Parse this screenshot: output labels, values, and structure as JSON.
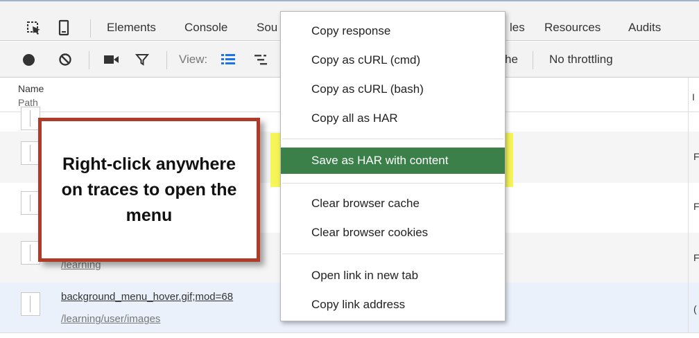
{
  "tabs": {
    "items": [
      "Elements",
      "Console",
      "Sou",
      "les",
      "Resources",
      "Audits"
    ]
  },
  "toolbar": {
    "view_label": "View:",
    "cache_fragment": "he",
    "throttling": "No throttling"
  },
  "table": {
    "header_name": "Name",
    "header_path": "Path",
    "header_right": "I",
    "rows": [
      {
        "name": "",
        "path": "",
        "right": ""
      },
      {
        "name": "",
        "path": "",
        "right": "F"
      },
      {
        "name": "",
        "path": "",
        "right": "F"
      },
      {
        "name": "",
        "path": "/learning",
        "right": "F"
      },
      {
        "name": "background_menu_hover.gif;mod=68",
        "path": "/learning/user/images",
        "right": "("
      }
    ]
  },
  "callout": {
    "text": "Right-click anywhere on traces to open the menu",
    "border_color": "#b03a28"
  },
  "context_menu": {
    "items": [
      "Copy response",
      "Copy as cURL (cmd)",
      "Copy as cURL (bash)",
      "Copy all as HAR",
      "Save as HAR with content",
      "Clear browser cache",
      "Clear browser cookies",
      "Open link in new tab",
      "Copy link address"
    ],
    "active_color": "#3a8048",
    "highlight_color": "#f4f43c"
  },
  "icons": [
    "inspect-icon",
    "device-icon",
    "record-icon",
    "clear-icon",
    "camera-icon",
    "filter-icon",
    "list-view-icon",
    "waterfall-view-icon"
  ]
}
